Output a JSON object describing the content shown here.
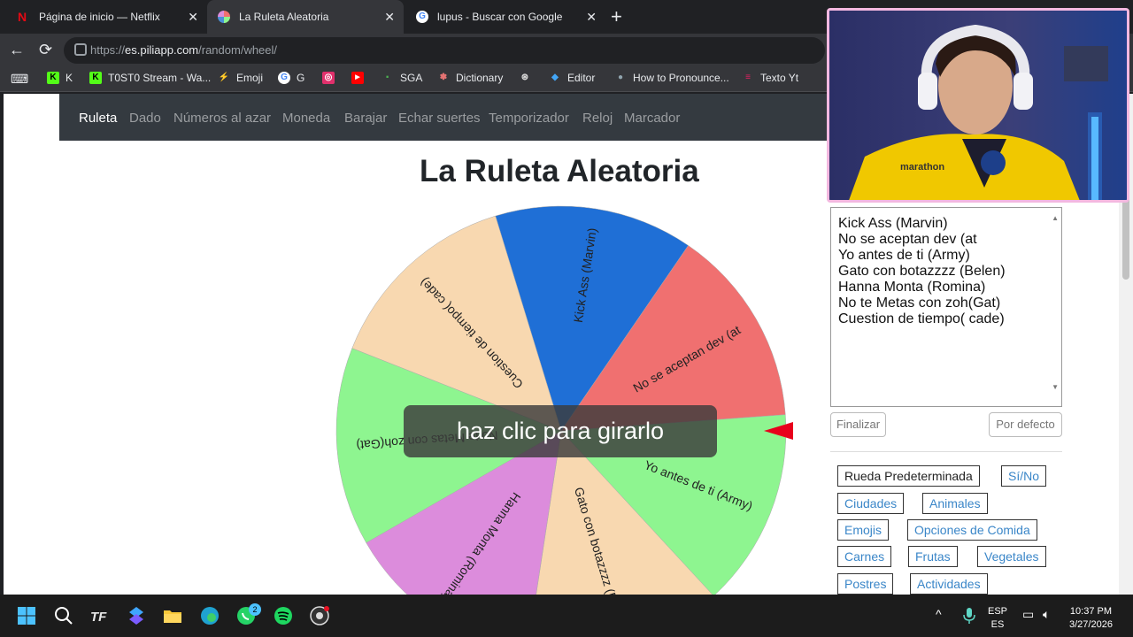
{
  "tabs": [
    {
      "title": "Página de inicio — Netflix",
      "favicon_color": "#e50914",
      "glyph": "N"
    },
    {
      "title": "La Ruleta Aleatoria",
      "favicon_color": "#4a90d9",
      "glyph": ""
    },
    {
      "title": "lupus - Buscar con Google",
      "favicon_color": "#ffffff",
      "glyph": "G"
    }
  ],
  "new_tab_glyph": "+",
  "close_glyph": "✕",
  "toolbar": {
    "back_glyph": "←",
    "reload_glyph": "⟳",
    "url_host": "es.piliapp.com",
    "url_scheme": "https://",
    "url_path": "/random/wheel/"
  },
  "bookmarks": [
    {
      "label": "K",
      "icon_color": "#53fc18",
      "glyph": "K"
    },
    {
      "label": "T0ST0 Stream - Wa...",
      "icon_color": "#53fc18",
      "glyph": "K"
    },
    {
      "label": "Emoji",
      "icon_color": "#ff4d6d",
      "glyph": "⚡"
    },
    {
      "label": "G",
      "icon_color": "#ffffff",
      "glyph": "G"
    },
    {
      "label": "",
      "icon_color": "#e1306c",
      "glyph": "◎"
    },
    {
      "label": "",
      "icon_color": "#ff0000",
      "glyph": "▶"
    },
    {
      "label": "SGA",
      "icon_color": "#2e7d32",
      "glyph": "·"
    },
    {
      "label": "Dictionary",
      "icon_color": "#d32f2f",
      "glyph": "✽"
    },
    {
      "label": "",
      "icon_color": "#ffffff",
      "glyph": "⊛"
    },
    {
      "label": "Editor",
      "icon_color": "#1e88e5",
      "glyph": "◆"
    },
    {
      "label": "How to Pronounce...",
      "icon_color": "#90a4ae",
      "glyph": "●"
    },
    {
      "label": "Texto Yt",
      "icon_color": "#e91e63",
      "glyph": "≡"
    }
  ],
  "site_nav": {
    "items": [
      "Ruleta",
      "Dado",
      "Números al azar",
      "Moneda",
      "Barajar",
      "Echar suertes",
      "Temporizador",
      "Reloj",
      "Marcador"
    ]
  },
  "page_title": "La Ruleta Aleatoria",
  "spin_button": "haz clic para girarlo",
  "wheel": {
    "segments": [
      {
        "label": "Kick Ass (Marvin)",
        "color": "#1f6fd6"
      },
      {
        "label": "No se aceptan dev (at",
        "color": "#f07070"
      },
      {
        "label": "Yo antes de ti (Army)",
        "color": "#8ef590"
      },
      {
        "label": "Gato con botazzzz (Belen)",
        "color": "#f8d8b0"
      },
      {
        "label": "Hanna Monta (Romina)",
        "color": "#dc8cdc"
      },
      {
        "label": "No te Metas con zoh(Gat)",
        "color": "#8ef590"
      },
      {
        "label": "Cuestion de tiempo( cade)",
        "color": "#f8d8b0"
      }
    ],
    "pointer_color": "#e8001c"
  },
  "entries_textarea": {
    "lines": [
      "Kick Ass (Marvin)",
      "No se aceptan dev (at",
      "Yo antes de ti (Army)",
      "Gato con botazzzz (Belen)",
      "Hanna Monta (Romina)",
      "No te Metas con zoh(Gat)",
      "Cuestion de tiempo( cade)"
    ]
  },
  "buttons": {
    "finish": "Finalizar",
    "default": "Por defecto"
  },
  "presets": [
    {
      "label": "Rueda Predeterminada",
      "style": "dark"
    },
    {
      "label": "Sí/No",
      "style": "link"
    },
    {
      "label": "Ciudades",
      "style": "link"
    },
    {
      "label": "Animales",
      "style": "link"
    },
    {
      "label": "Emojis",
      "style": "link"
    },
    {
      "label": "Opciones de Comida",
      "style": "link"
    },
    {
      "label": "Carnes",
      "style": "link"
    },
    {
      "label": "Frutas",
      "style": "link"
    },
    {
      "label": "Vegetales",
      "style": "link"
    },
    {
      "label": "Postres",
      "style": "link"
    },
    {
      "label": "Actividades",
      "style": "link"
    }
  ],
  "webcam": {
    "shirt_text": "marathon"
  },
  "taskbar": {
    "whatsapp_badge": "2",
    "lang_top": "ESP",
    "lang_bottom": "ES",
    "time": "10:37 PM",
    "date": "3/27/2026",
    "chevron": "^"
  }
}
